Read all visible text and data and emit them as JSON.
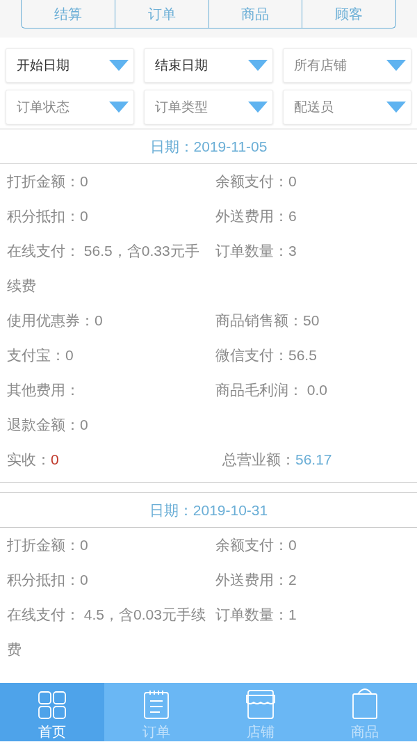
{
  "segments": [
    {
      "label": "结算"
    },
    {
      "label": "订单"
    },
    {
      "label": "商品"
    },
    {
      "label": "顾客"
    }
  ],
  "filters": [
    {
      "label": "开始日期",
      "set": true
    },
    {
      "label": "结束日期",
      "set": true
    },
    {
      "label": "所有店铺",
      "set": false
    },
    {
      "label": "订单状态",
      "set": false
    },
    {
      "label": "订单类型",
      "set": false
    },
    {
      "label": "配送员",
      "set": false
    }
  ],
  "days": [
    {
      "date": "日期：2019-11-05",
      "stats": [
        {
          "label": "打折金额：",
          "value": "0"
        },
        {
          "label": "余额支付：",
          "value": "0"
        },
        {
          "label": "积分抵扣：",
          "value": "0"
        },
        {
          "label": "外送费用：",
          "value": "6"
        },
        {
          "label": "在线支付：",
          "value": " 56.5，含0.33元手续费"
        },
        {
          "label": "订单数量：",
          "value": "3"
        },
        {
          "label": "使用优惠券：",
          "value": "0"
        },
        {
          "label": "商品销售额：",
          "value": "50"
        },
        {
          "label": "支付宝：",
          "value": "0"
        },
        {
          "label": "微信支付：",
          "value": "56.5"
        },
        {
          "label": "其他费用："
        },
        {
          "label": "商品毛利润：",
          "value": " 0.0"
        },
        {
          "label": "退款金额：",
          "value": "0"
        }
      ],
      "totals": [
        {
          "label": "实收：",
          "value": "0",
          "color": "#c0392b"
        },
        {
          "label": "总营业额：",
          "value": "56.17",
          "color": "#6aaed6"
        }
      ]
    },
    {
      "date": "日期：2019-10-31",
      "stats": [
        {
          "label": "打折金额：",
          "value": "0"
        },
        {
          "label": "余额支付：",
          "value": "0"
        },
        {
          "label": "积分抵扣：",
          "value": "0"
        },
        {
          "label": "外送费用：",
          "value": "2"
        },
        {
          "label": "在线支付：",
          "value": " 4.5，含0.03元手续费"
        },
        {
          "label": "订单数量：",
          "value": "1"
        }
      ]
    }
  ],
  "tabbar": [
    {
      "label": "首页",
      "selected": true
    },
    {
      "label": "订单",
      "selected": false
    },
    {
      "label": "店铺",
      "selected": false
    },
    {
      "label": "商品",
      "selected": false
    }
  ]
}
